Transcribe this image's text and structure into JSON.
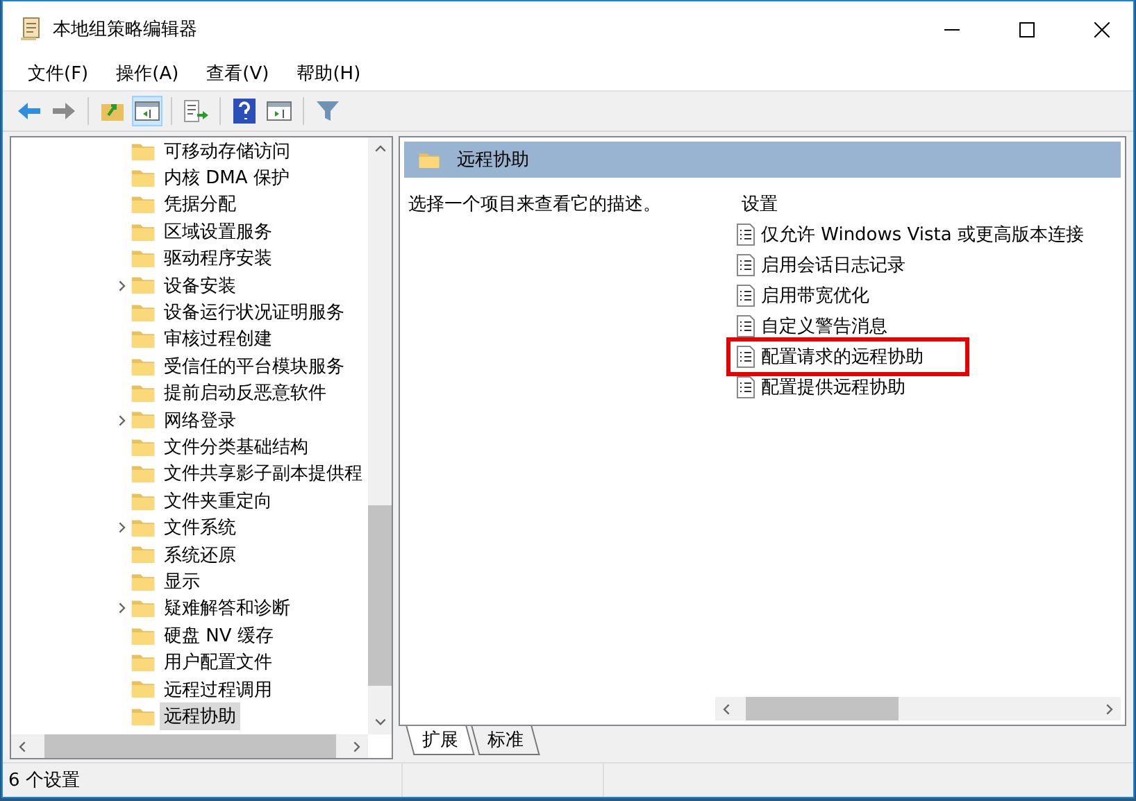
{
  "window": {
    "title": "本地组策略编辑器"
  },
  "menu": [
    "文件(F)",
    "操作(A)",
    "查看(V)",
    "帮助(H)"
  ],
  "toolbar": [
    {
      "kind": "back",
      "pressed": false
    },
    {
      "kind": "forward",
      "pressed": false
    },
    {
      "kind": "sep"
    },
    {
      "kind": "up",
      "pressed": false
    },
    {
      "kind": "tree",
      "pressed": true
    },
    {
      "kind": "sep"
    },
    {
      "kind": "export",
      "pressed": false
    },
    {
      "kind": "sep"
    },
    {
      "kind": "help",
      "pressed": false
    },
    {
      "kind": "pane",
      "pressed": false
    },
    {
      "kind": "sep"
    },
    {
      "kind": "filter",
      "pressed": false
    }
  ],
  "tree": [
    {
      "label": "可移动存储访问",
      "has_children": false,
      "selected": false
    },
    {
      "label": "内核 DMA 保护",
      "has_children": false,
      "selected": false
    },
    {
      "label": "凭据分配",
      "has_children": false,
      "selected": false
    },
    {
      "label": "区域设置服务",
      "has_children": false,
      "selected": false
    },
    {
      "label": "驱动程序安装",
      "has_children": false,
      "selected": false
    },
    {
      "label": "设备安装",
      "has_children": true,
      "selected": false
    },
    {
      "label": "设备运行状况证明服务",
      "has_children": false,
      "selected": false
    },
    {
      "label": "审核过程创建",
      "has_children": false,
      "selected": false
    },
    {
      "label": "受信任的平台模块服务",
      "has_children": false,
      "selected": false
    },
    {
      "label": "提前启动反恶意软件",
      "has_children": false,
      "selected": false
    },
    {
      "label": "网络登录",
      "has_children": true,
      "selected": false
    },
    {
      "label": "文件分类基础结构",
      "has_children": false,
      "selected": false
    },
    {
      "label": "文件共享影子副本提供程",
      "has_children": false,
      "selected": false
    },
    {
      "label": "文件夹重定向",
      "has_children": false,
      "selected": false
    },
    {
      "label": "文件系统",
      "has_children": true,
      "selected": false
    },
    {
      "label": "系统还原",
      "has_children": false,
      "selected": false
    },
    {
      "label": "显示",
      "has_children": false,
      "selected": false
    },
    {
      "label": "疑难解答和诊断",
      "has_children": true,
      "selected": false
    },
    {
      "label": "硬盘 NV 缓存",
      "has_children": false,
      "selected": false
    },
    {
      "label": "用户配置文件",
      "has_children": false,
      "selected": false
    },
    {
      "label": "远程过程调用",
      "has_children": false,
      "selected": false
    },
    {
      "label": "远程协助",
      "has_children": false,
      "selected": true
    }
  ],
  "details": {
    "title": "远程协助",
    "description": "选择一个项目来查看它的描述。",
    "settings_heading": "设置",
    "settings": [
      {
        "label": "仅允许 Windows Vista 或更高版本连接",
        "highlighted": false
      },
      {
        "label": "启用会话日志记录",
        "highlighted": false
      },
      {
        "label": "启用带宽优化",
        "highlighted": false
      },
      {
        "label": "自定义警告消息",
        "highlighted": false
      },
      {
        "label": "配置请求的远程协助",
        "highlighted": true
      },
      {
        "label": "配置提供远程协助",
        "highlighted": false
      }
    ]
  },
  "tabs": [
    {
      "label": "扩展",
      "selected": true
    },
    {
      "label": "标准",
      "selected": false
    }
  ],
  "status_bar": "6 个设置"
}
